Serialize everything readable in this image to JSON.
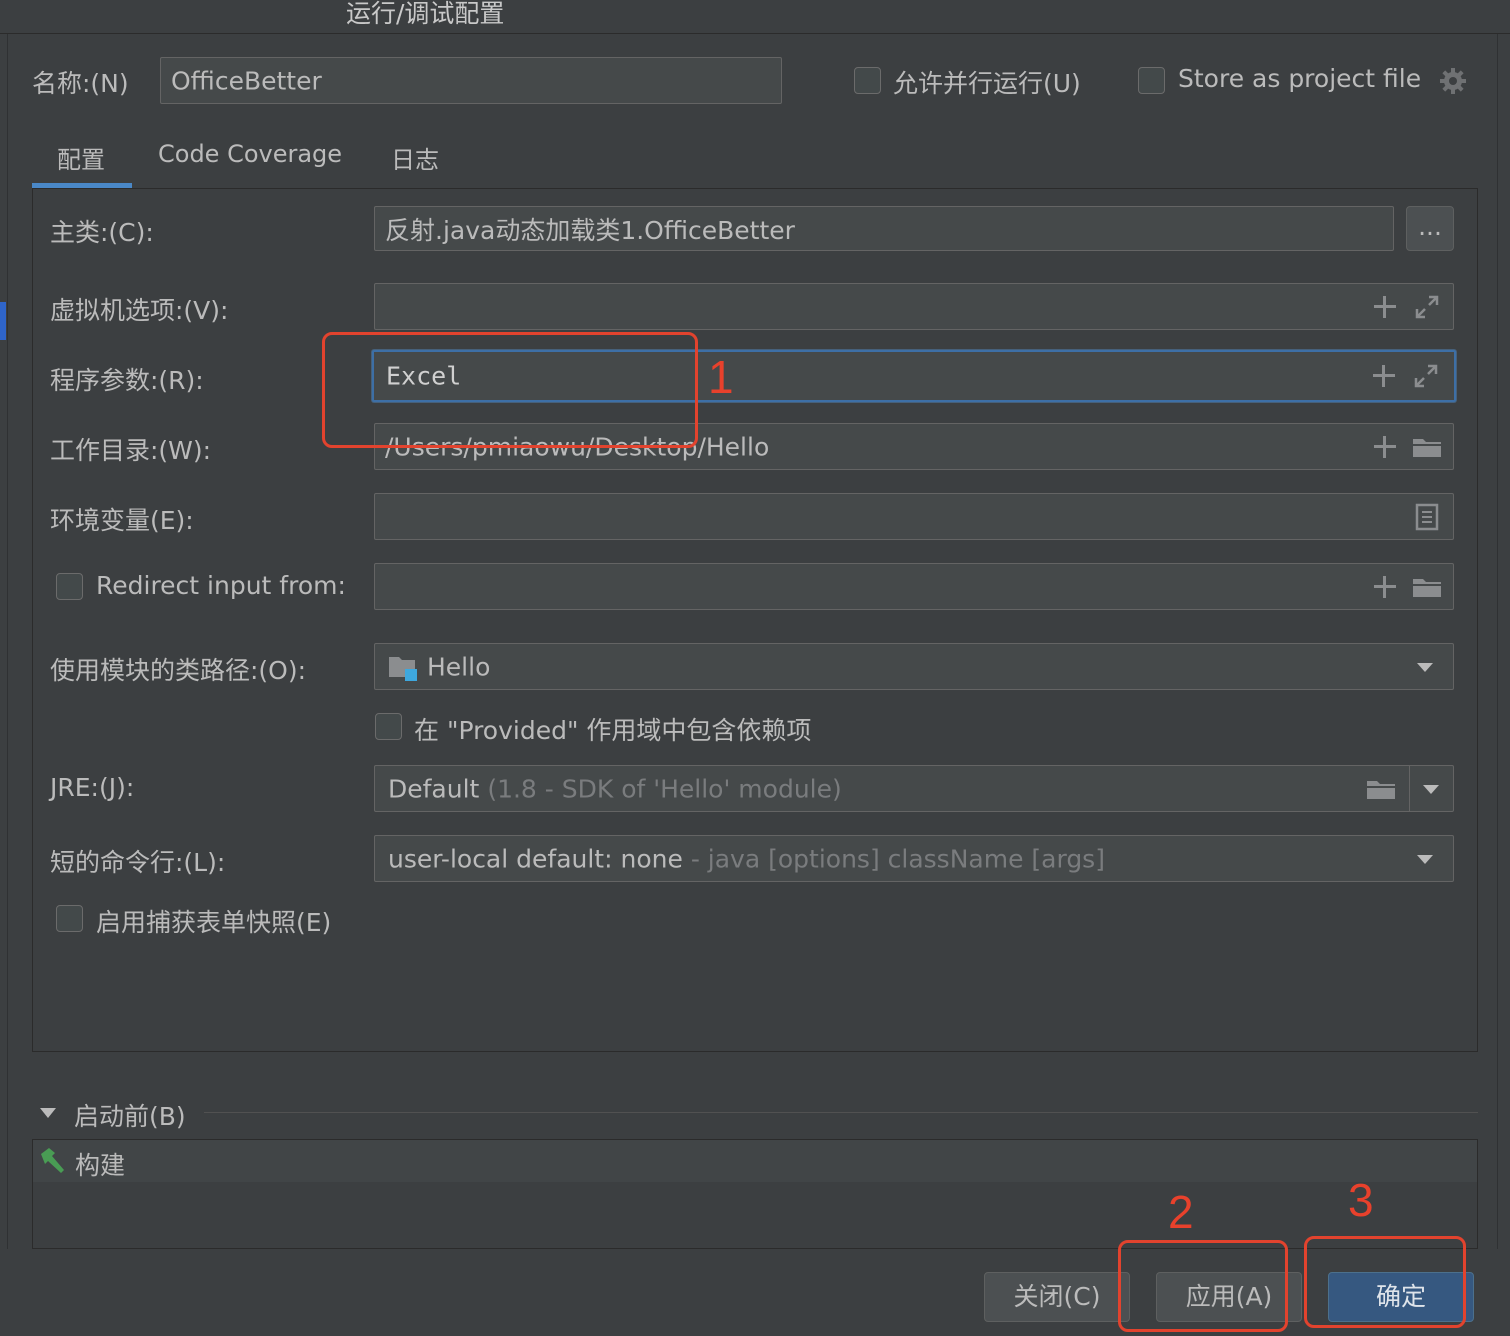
{
  "window": {
    "title": "运行/调试配置"
  },
  "header": {
    "name_label": "名称:(N)",
    "name_value": "OfficeBetter",
    "parallel_label": "允许并行运行(U)",
    "store_label": "Store as project file"
  },
  "tabs": [
    {
      "label": "配置",
      "active": true
    },
    {
      "label": "Code Coverage",
      "active": false
    },
    {
      "label": "日志",
      "active": false
    }
  ],
  "form": {
    "main_class_label": "主类:(C):",
    "main_class_value": "反射.java动态加载类1.OfficeBetter",
    "browse_label": "...",
    "vm_options_label": "虚拟机选项:(V):",
    "vm_options_value": "",
    "program_args_label": "程序参数:(R):",
    "program_args_value": "Excel",
    "workdir_label": "工作目录:(W):",
    "workdir_value": "/Users/pmiaowu/Desktop/Hello",
    "env_label": "环境变量(E):",
    "env_value": "",
    "redirect_label": "Redirect input from:",
    "redirect_value": "",
    "module_label": "使用模块的类路径:(O):",
    "module_value": "Hello",
    "provided_label": "在 \"Provided\" 作用域中包含依赖项",
    "jre_label": "JRE:(J):",
    "jre_value": "Default",
    "jre_hint": "(1.8 - SDK of 'Hello' module)",
    "shorten_label": "短的命令行:(L):",
    "shorten_value": "user-local default: none",
    "shorten_hint": "- java [options] className [args]",
    "snapshot_label": "启用捕获表单快照(E)"
  },
  "before_launch": {
    "label": "启动前(B)",
    "items": [
      "构建"
    ]
  },
  "footer": {
    "close_label": "关闭(C)",
    "apply_label": "应用(A)",
    "ok_label": "确定"
  },
  "annotations": {
    "step1": "1",
    "step2": "2",
    "step3": "3",
    "color": "#e2432e"
  },
  "colors": {
    "background": "#3c3f41",
    "field": "#45494a",
    "accent": "#4a88c7",
    "primary_button": "#365880"
  }
}
